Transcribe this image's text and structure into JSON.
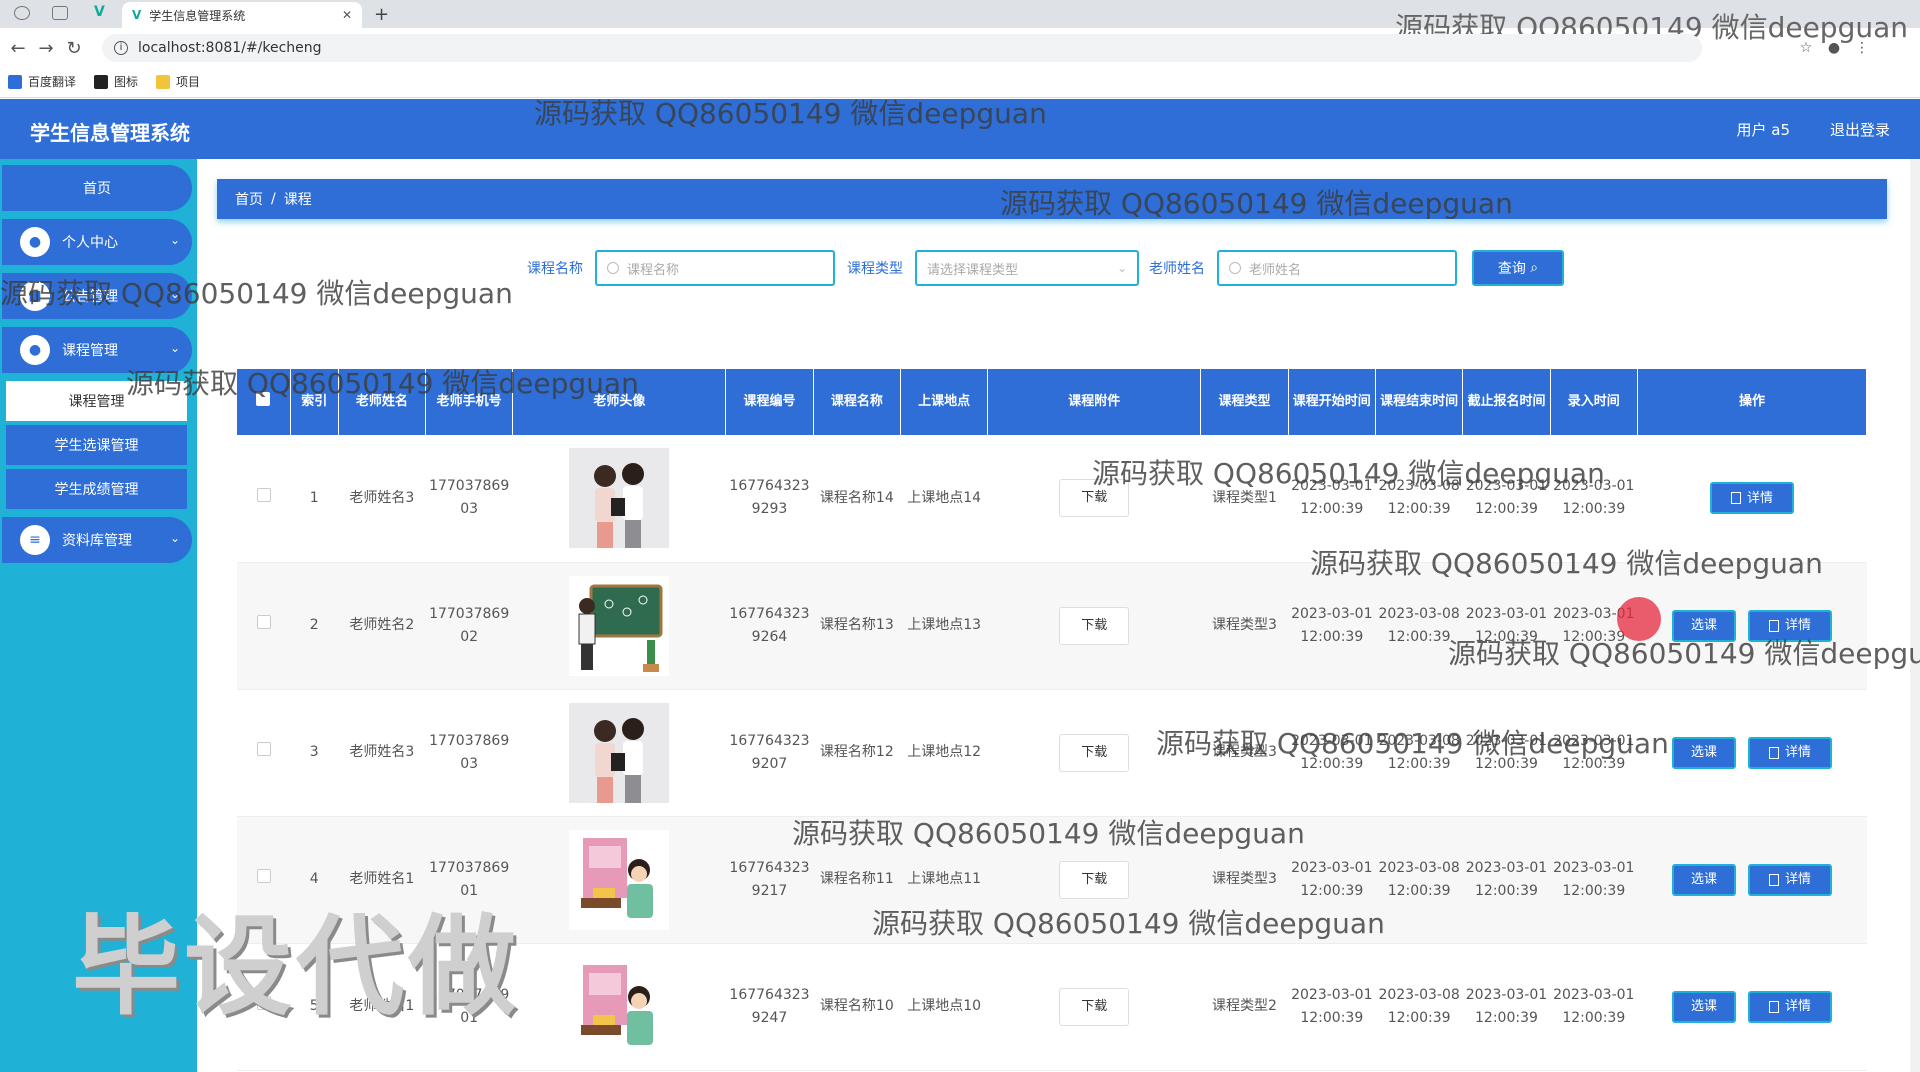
{
  "browser": {
    "tab_title": "学生信息管理系统",
    "url": "localhost:8081/#/kecheng",
    "bookmarks": [
      "百度翻译",
      "图标",
      "项目"
    ]
  },
  "header": {
    "brand": "学生信息管理系统",
    "user": "用户 a5",
    "logout": "退出登录",
    "color": "#2e6ed6"
  },
  "sidebar": {
    "home": "首页",
    "personal": "个人中心",
    "notice": "公告管理",
    "course": "课程管理",
    "course_sub": [
      "课程管理",
      "学生选课管理",
      "学生成绩管理"
    ],
    "resource": "资料库管理",
    "color": "#1fb1d6"
  },
  "breadcrumb": {
    "home": "首页",
    "sep": "/",
    "current": "课程"
  },
  "search": {
    "name_label": "课程名称",
    "name_placeholder": "课程名称",
    "type_label": "课程类型",
    "type_placeholder": "请选择课程类型",
    "teacher_label": "老师姓名",
    "teacher_placeholder": "老师姓名",
    "query": "查询"
  },
  "table": {
    "headers": [
      "索引",
      "老师姓名",
      "老师手机号",
      "老师头像",
      "课程编号",
      "课程名称",
      "上课地点",
      "课程附件",
      "课程类型",
      "课程开始时间",
      "课程结束时间",
      "截止报名时间",
      "录入时间",
      "操作"
    ],
    "download": "下载",
    "select": "选课",
    "detail": "详情",
    "rows": [
      {
        "idx": "1",
        "teacher": "老师姓名3",
        "phone": "17703786903",
        "avatar": "teacher-two-women",
        "code": "1677643239293",
        "name": "课程名称14",
        "place": "上课地点14",
        "type": "课程类型1",
        "start": "2023-03-01 12:00:39",
        "end": "2023-03-08 12:00:39",
        "deadline": "2023-03-01 12:00:39",
        "created": "2023-03-01 12:00:39",
        "has_select": false
      },
      {
        "idx": "2",
        "teacher": "老师姓名2",
        "phone": "17703786902",
        "avatar": "teacher-blackboard",
        "code": "1677643239264",
        "name": "课程名称13",
        "place": "上课地点13",
        "type": "课程类型3",
        "start": "2023-03-01 12:00:39",
        "end": "2023-03-08 12:00:39",
        "deadline": "2023-03-01 12:00:39",
        "created": "2023-03-01 12:00:39",
        "has_select": true
      },
      {
        "idx": "3",
        "teacher": "老师姓名3",
        "phone": "17703786903",
        "avatar": "teacher-two-women",
        "code": "1677643239207",
        "name": "课程名称12",
        "place": "上课地点12",
        "type": "课程类型3",
        "start": "2023-03-01 12:00:39",
        "end": "2023-03-08 12:00:39",
        "deadline": "2023-03-01 12:00:39",
        "created": "2023-03-01 12:00:39",
        "has_select": true
      },
      {
        "idx": "4",
        "teacher": "老师姓名1",
        "phone": "17703786901",
        "avatar": "teacher-chinese-poster",
        "code": "1677643239217",
        "name": "课程名称11",
        "place": "上课地点11",
        "type": "课程类型3",
        "start": "2023-03-01 12:00:39",
        "end": "2023-03-08 12:00:39",
        "deadline": "2023-03-01 12:00:39",
        "created": "2023-03-01 12:00:39",
        "has_select": true
      },
      {
        "idx": "5",
        "teacher": "老师姓名1",
        "phone": "17703786901",
        "avatar": "teacher-chinese-poster",
        "code": "1677643239247",
        "name": "课程名称10",
        "place": "上课地点10",
        "type": "课程类型2",
        "start": "2023-03-01 12:00:39",
        "end": "2023-03-08 12:00:39",
        "deadline": "2023-03-01 12:00:39",
        "created": "2023-03-01 12:00:39",
        "has_select": true
      }
    ]
  },
  "watermarks": {
    "contact": "源码获取 QQ86050149 微信deepguan",
    "big": "毕设代做"
  }
}
